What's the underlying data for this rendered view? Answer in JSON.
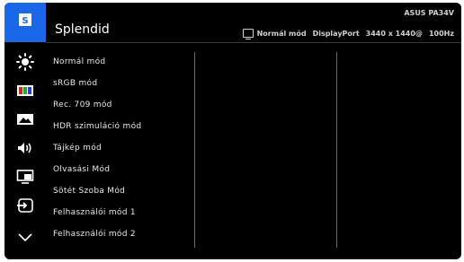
{
  "header": {
    "title": "Splendid",
    "model": "ASUS PA34V",
    "mode": "Normál mód",
    "input": "DisplayPort",
    "resolution": "3440 x 1440@",
    "refresh": "100Hz"
  },
  "sidebar": {
    "items": [
      {
        "icon": "splendid-icon",
        "active": true
      },
      {
        "icon": "brightness-icon"
      },
      {
        "icon": "color-icon"
      },
      {
        "icon": "image-icon"
      },
      {
        "icon": "sound-icon"
      },
      {
        "icon": "pip-icon"
      },
      {
        "icon": "input-select-icon"
      },
      {
        "icon": "chevron-down-icon"
      }
    ],
    "accent": "#1a68e8"
  },
  "menu": {
    "items": [
      "Normál mód",
      "sRGB mód",
      "Rec. 709 mód",
      "HDR szimuláció mód",
      "Tájkép mód",
      "Olvasási Mód",
      "Sötét Szoba Mód",
      "Felhasználói mód 1",
      "Felhasználói mód 2"
    ]
  }
}
